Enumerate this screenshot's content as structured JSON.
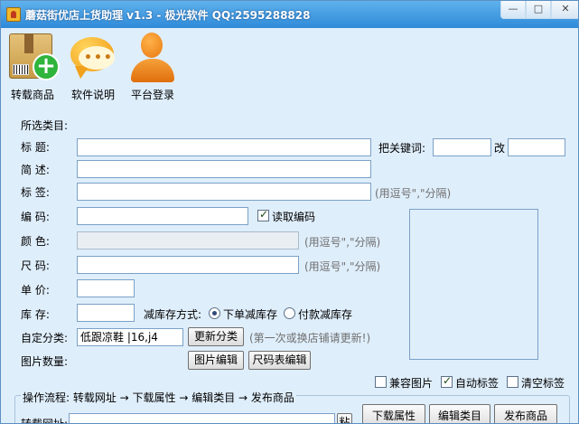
{
  "window": {
    "title": "蘑菇街优店上货助理 v1.3 - 极光软件 QQ:2595288828",
    "minimize": "—",
    "maximize": "□",
    "close": "✕"
  },
  "toolbar": [
    {
      "label": "转载商品",
      "icon": "product-box-add-icon"
    },
    {
      "label": "软件说明",
      "icon": "speech-bubble-icon"
    },
    {
      "label": "平台登录",
      "icon": "user-icon"
    }
  ],
  "form": {
    "selected_category_label": "所选类目:",
    "title_label": "标    题:",
    "title_value": "",
    "keyword_label": "把关键词:",
    "keyword_from": "",
    "keyword_to_label": "改",
    "keyword_to": "",
    "summary_label": "简    述:",
    "summary_value": "",
    "tags_label": "标    签:",
    "tags_value": "",
    "tags_hint": "(用逗号\",\"分隔)",
    "code_label": "编    码:",
    "code_value": "",
    "read_code_label": "读取编码",
    "read_code_checked": true,
    "color_label": "颜    色:",
    "color_value": "",
    "color_hint": "(用逗号\",\"分隔)",
    "size_label": "尺    码:",
    "size_value": "",
    "size_hint": "(用逗号\",\"分隔)",
    "price_label": "单    价:",
    "price_value": "",
    "stock_label": "库    存:",
    "stock_value": "",
    "stock_mode_label": "减库存方式:",
    "stock_mode_options": [
      {
        "label": "下单减库存",
        "checked": true
      },
      {
        "label": "付款减库存",
        "checked": false
      }
    ],
    "custom_category_label": "自定分类:",
    "custom_category_value": "低跟凉鞋 |16,j4",
    "update_category_button": "更新分类",
    "update_category_hint": "(第一次或换店铺请更新!)",
    "image_count_label": "图片数量:",
    "image_edit_button": "图片编辑",
    "size_table_button": "尺码表编辑"
  },
  "options": [
    {
      "label": "兼容图片",
      "checked": false
    },
    {
      "label": "自动标签",
      "checked": true
    },
    {
      "label": "清空标签",
      "checked": false
    }
  ],
  "workflow": {
    "group_title": "操作流程: 转载网址 → 下载属性 → 编辑类目 → 发布商品",
    "url_label": "转载网址:",
    "url_value": "",
    "paste_button": "粘",
    "download_button": "下载属性",
    "edit_category_button": "编辑类目",
    "publish_button": "发布商品"
  }
}
